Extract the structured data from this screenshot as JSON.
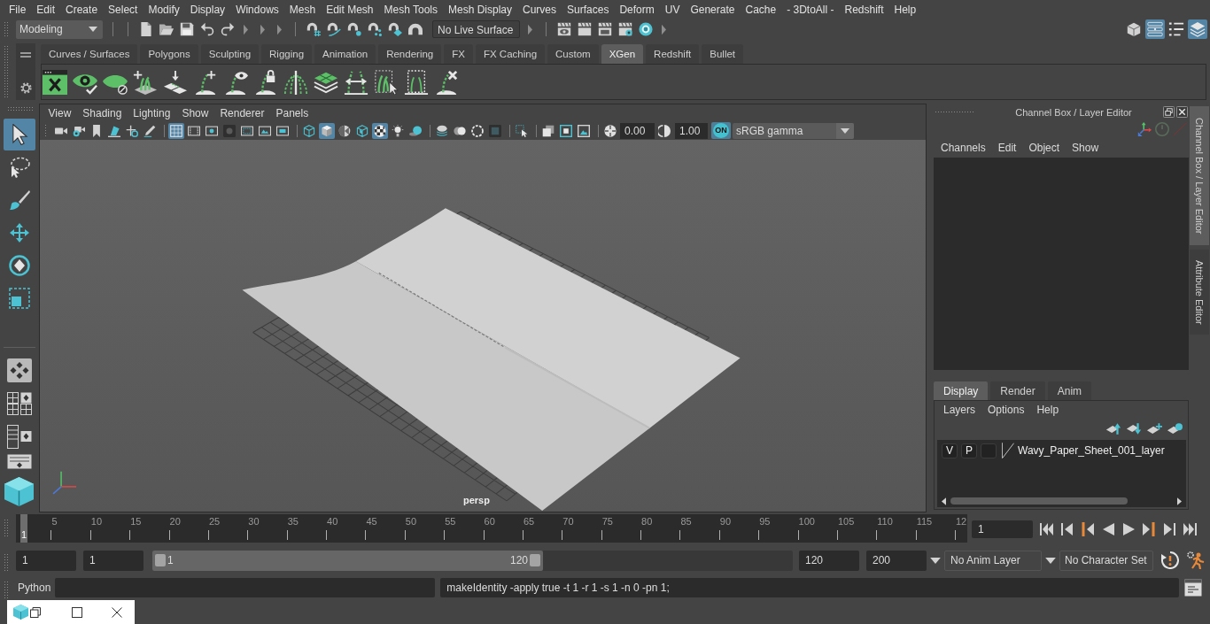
{
  "menu_bar": [
    "File",
    "Edit",
    "Create",
    "Select",
    "Modify",
    "Display",
    "Windows",
    "Mesh",
    "Edit Mesh",
    "Mesh Tools",
    "Mesh Display",
    "Curves",
    "Surfaces",
    "Deform",
    "UV",
    "Generate",
    "Cache",
    "- 3DtoAll -",
    "Redshift",
    "Help"
  ],
  "status_line": {
    "menu_set": "Modeling",
    "live_surface": "No Live Surface",
    "panel_toggles": [
      {
        "selected": false
      },
      {
        "selected": true
      },
      {
        "selected": false
      },
      {
        "selected": true
      }
    ]
  },
  "shelf": {
    "tabs": [
      {
        "label": "Curves / Surfaces",
        "selected": false
      },
      {
        "label": "Polygons",
        "selected": false
      },
      {
        "label": "Sculpting",
        "selected": false
      },
      {
        "label": "Rigging",
        "selected": false
      },
      {
        "label": "Animation",
        "selected": false
      },
      {
        "label": "Rendering",
        "selected": false
      },
      {
        "label": "FX",
        "selected": false
      },
      {
        "label": "FX Caching",
        "selected": false
      },
      {
        "label": "Custom",
        "selected": false
      },
      {
        "label": "XGen",
        "selected": true
      },
      {
        "label": "Redshift",
        "selected": false
      },
      {
        "label": "Bullet",
        "selected": false
      }
    ]
  },
  "toolbox": {
    "tools": [
      {
        "selected": true
      },
      {
        "selected": false
      },
      {
        "selected": false
      },
      {
        "selected": false
      },
      {
        "selected": false
      },
      {
        "selected": false
      }
    ]
  },
  "viewport": {
    "menu": [
      "View",
      "Shading",
      "Lighting",
      "Show",
      "Renderer",
      "Panels"
    ],
    "tools": [
      {
        "selected": false
      },
      {
        "selected": false
      },
      {
        "selected": false
      },
      {
        "selected": false
      },
      {
        "selected": false
      },
      {
        "selected": false
      },
      {
        "selected": true
      },
      {
        "selected": false
      },
      {
        "selected": false
      },
      {
        "selected": false
      },
      {
        "selected": false
      },
      {
        "selected": false
      },
      {
        "selected": false
      },
      {
        "selected": false
      },
      {
        "selected": true
      },
      {
        "selected": false
      },
      {
        "selected": false
      },
      {
        "selected": true
      },
      {
        "selected": false
      },
      {
        "selected": false
      },
      {
        "selected": false
      },
      {
        "selected": false
      },
      {
        "selected": false
      },
      {
        "selected": false
      },
      {
        "selected": false
      },
      {
        "selected": false
      },
      {
        "selected": false
      },
      {
        "selected": false
      },
      {
        "selected": false
      },
      {
        "selected": false
      }
    ],
    "exposure": "0.00",
    "gamma": "1.00",
    "color_management": {
      "label": "ON",
      "on": true
    },
    "view_transform": "sRGB gamma",
    "camera_label": "persp"
  },
  "channel_box": {
    "title": "Channel Box / Layer Editor",
    "menu": [
      "Channels",
      "Edit",
      "Object",
      "Show"
    ]
  },
  "layer_editor": {
    "tabs": [
      {
        "label": "Display",
        "selected": true
      },
      {
        "label": "Render",
        "selected": false
      },
      {
        "label": "Anim",
        "selected": false
      }
    ],
    "menu": [
      "Layers",
      "Options",
      "Help"
    ],
    "layers": [
      {
        "visibility": "V",
        "playback": "P",
        "name": "Wavy_Paper_Sheet_001_layer"
      }
    ]
  },
  "side_tabs": [
    {
      "label": "Channel Box / Layer Editor",
      "selected": true
    },
    {
      "label": "Attribute Editor",
      "selected": false
    }
  ],
  "time_slider": {
    "tick_labels": [
      "5",
      "10",
      "15",
      "20",
      "25",
      "30",
      "35",
      "40",
      "45",
      "50",
      "55",
      "60",
      "65",
      "70",
      "75",
      "80",
      "85",
      "90",
      "95",
      "100",
      "105",
      "110",
      "115",
      "12"
    ],
    "current_frame_marker": "1",
    "level": 0,
    "current_frame": "1"
  },
  "range_slider": {
    "animation_start": "1",
    "playback_start": "1",
    "range_start": "1",
    "range_end": "120",
    "level": 0.61,
    "playback_end": "120",
    "animation_end": "200",
    "anim_layer": "No Anim Layer",
    "character_set": "No Character Set"
  },
  "command_line": {
    "language": "Python",
    "result": "makeIdentity -apply true -t 1 -r 1 -s 1 -n 0 -pn 1;"
  }
}
